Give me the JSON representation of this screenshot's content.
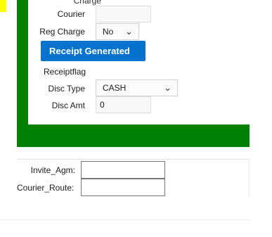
{
  "top_cut_label": "Charge",
  "form": {
    "courier_label": "Courier",
    "courier_value": "",
    "reg_charge_label": "Reg Charge",
    "reg_charge_value": "No",
    "receipt_button_label": "Receipt Generated",
    "receiptflag_label": "Receiptflag",
    "disc_type_label": "Disc Type",
    "disc_type_value": "CASH",
    "disc_amt_label": "Disc Amt",
    "disc_amt_value": "0"
  },
  "extra": {
    "invite_agm_label": "Invite_Agm:",
    "invite_agm_value": "",
    "courier_route_label": "Courier_Route:",
    "courier_route_value": ""
  },
  "colors": {
    "frame_green": "#008000",
    "button_blue": "#0572ce",
    "tab_yellow": "#ffff00"
  },
  "icons": {
    "select_chevron": "chevron-down-icon",
    "button_icon": "camera-icon"
  }
}
